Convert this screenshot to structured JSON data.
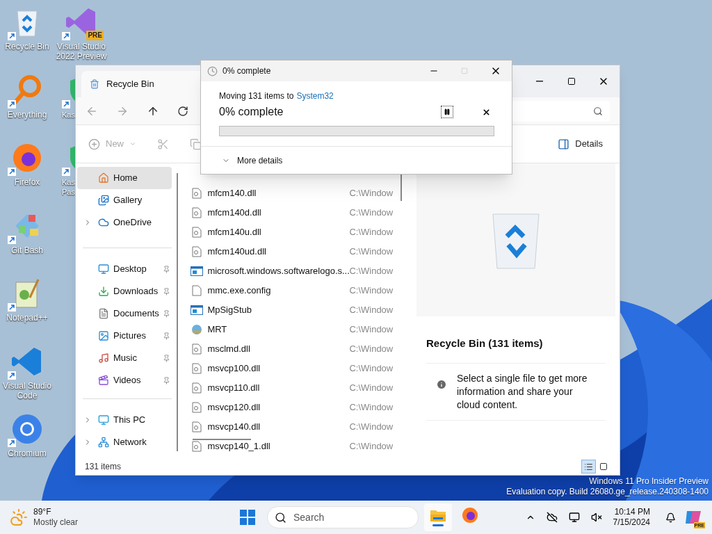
{
  "desktop": {
    "columns": [
      [
        {
          "label": "Recycle Bin",
          "kind": "recycle"
        },
        {
          "label": "Everything",
          "kind": "everything"
        },
        {
          "label": "Firefox",
          "kind": "firefox"
        },
        {
          "label": "Git Bash",
          "kind": "git"
        },
        {
          "label": "Notepad++",
          "kind": "notepad"
        },
        {
          "label": "Visual Studio Code",
          "kind": "vscode"
        },
        {
          "label": "Chromium",
          "kind": "chromium"
        }
      ],
      [
        {
          "label": "Visual Studio 2022 Preview",
          "kind": "vs",
          "badge": "PRE"
        },
        {
          "label": "Kas",
          "kind": "kas"
        },
        {
          "label": "Kas Pas",
          "kind": "kas"
        }
      ]
    ],
    "watermark": [
      "Windows 11 Pro Insider Preview",
      "Evaluation copy. Build 26080.ge_release.240308-1400"
    ]
  },
  "explorer": {
    "title": "Recycle Bin",
    "toolbar": {
      "new": "New",
      "details": "Details"
    },
    "sidebar": [
      [
        {
          "label": "Home",
          "kind": "home",
          "expandable": false,
          "pinned": false,
          "selected": true
        },
        {
          "label": "Gallery",
          "kind": "gallery",
          "expandable": false,
          "pinned": false,
          "selected": false
        },
        {
          "label": "OneDrive",
          "kind": "onedrive",
          "expandable": true,
          "pinned": false,
          "selected": false
        }
      ],
      [
        {
          "label": "Desktop",
          "kind": "desktop",
          "expandable": false,
          "pinned": true,
          "selected": false
        },
        {
          "label": "Downloads",
          "kind": "downloads",
          "expandable": false,
          "pinned": true,
          "selected": false
        },
        {
          "label": "Documents",
          "kind": "documents",
          "expandable": false,
          "pinned": true,
          "selected": false
        },
        {
          "label": "Pictures",
          "kind": "pictures",
          "expandable": false,
          "pinned": true,
          "selected": false
        },
        {
          "label": "Music",
          "kind": "music",
          "expandable": false,
          "pinned": true,
          "selected": false
        },
        {
          "label": "Videos",
          "kind": "videos",
          "expandable": false,
          "pinned": true,
          "selected": false
        }
      ],
      [
        {
          "label": "This PC",
          "kind": "pc",
          "expandable": true,
          "pinned": false,
          "selected": false
        },
        {
          "label": "Network",
          "kind": "network",
          "expandable": true,
          "pinned": false,
          "selected": false
        }
      ]
    ],
    "files": [
      {
        "name": "mfcm140.dll",
        "kind": "dll",
        "location": "C:\\Window"
      },
      {
        "name": "mfcm140d.dll",
        "kind": "dll",
        "location": "C:\\Window"
      },
      {
        "name": "mfcm140u.dll",
        "kind": "dll",
        "location": "C:\\Window"
      },
      {
        "name": "mfcm140ud.dll",
        "kind": "dll",
        "location": "C:\\Window"
      },
      {
        "name": "microsoft.windows.softwarelogo.s...",
        "kind": "exe",
        "location": "C:\\Window"
      },
      {
        "name": "mmc.exe.config",
        "kind": "blank",
        "location": "C:\\Window"
      },
      {
        "name": "MpSigStub",
        "kind": "exe",
        "location": "C:\\Window"
      },
      {
        "name": "MRT",
        "kind": "mrt",
        "location": "C:\\Window"
      },
      {
        "name": "msclmd.dll",
        "kind": "dll",
        "location": "C:\\Window"
      },
      {
        "name": "msvcp100.dll",
        "kind": "dll",
        "location": "C:\\Window"
      },
      {
        "name": "msvcp110.dll",
        "kind": "dll",
        "location": "C:\\Window"
      },
      {
        "name": "msvcp120.dll",
        "kind": "dll",
        "location": "C:\\Window"
      },
      {
        "name": "msvcp140.dll",
        "kind": "dll",
        "location": "C:\\Window"
      },
      {
        "name": "msvcp140_1.dll",
        "kind": "dll",
        "location": "C:\\Window"
      }
    ],
    "details": {
      "title": "Recycle Bin (131 items)",
      "info": "Select a single file to get more information and share your cloud content."
    },
    "status": "131 items",
    "views": [
      {
        "kind": "details",
        "selected": true
      },
      {
        "kind": "tiles",
        "selected": false
      }
    ]
  },
  "dialog": {
    "title": "0% complete",
    "message": "Moving 131 items to",
    "target": "System32",
    "progress_title": "0% complete",
    "level": 0,
    "paused": false,
    "more": "More details"
  },
  "taskbar": {
    "weather": {
      "temp": "89°F",
      "condition": "Mostly clear"
    },
    "search": "Search",
    "apps": [
      {
        "kind": "explorer",
        "running": true
      },
      {
        "kind": "firefox",
        "running": false
      }
    ],
    "time": "10:14 PM",
    "date": "7/15/2024",
    "copilot_badge": "PRE"
  }
}
